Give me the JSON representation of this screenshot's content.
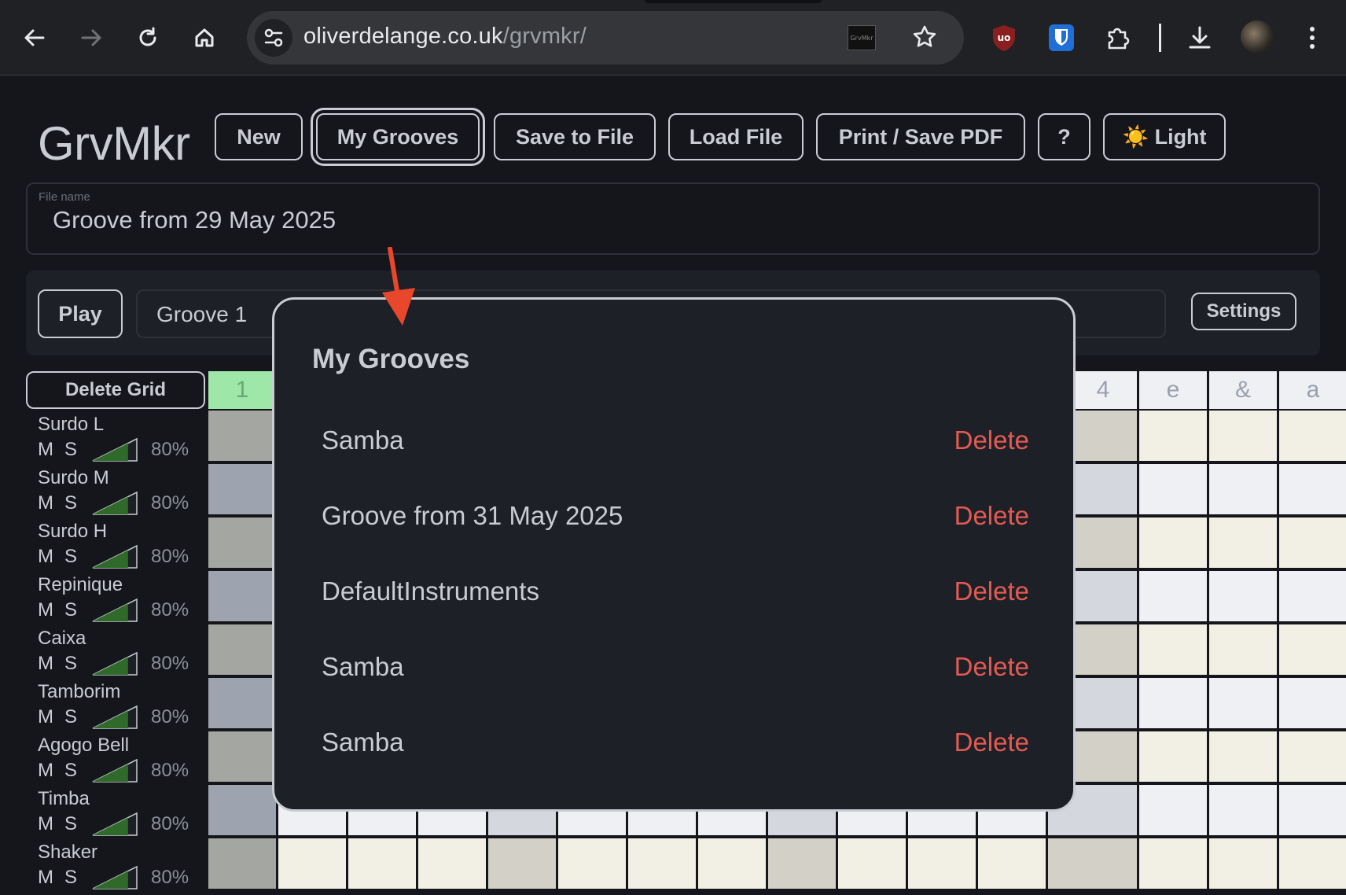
{
  "browser": {
    "url_domain": "oliverdelange.co.uk",
    "url_path": "/grvmkr/",
    "extension_thumb_label": "GrvMkr"
  },
  "app": {
    "logo": "GrvMkr",
    "toolbar": {
      "new_label": "New",
      "my_grooves_label": "My Grooves",
      "save_label": "Save to File",
      "load_label": "Load File",
      "print_label": "Print / Save PDF",
      "help_label": "?",
      "theme_label": "☀️ Light"
    },
    "file_name_label": "File name",
    "file_name_value": "Groove from 29 May 2025",
    "play_label": "Play",
    "groove_name": "Groove 1",
    "settings_label": "Settings",
    "delete_grid_label": "Delete Grid",
    "beat_headers": [
      "1",
      "4",
      "e",
      "&",
      "a"
    ],
    "instruments": [
      {
        "name": "Surdo L",
        "mute": "M",
        "solo": "S",
        "volume": "80%",
        "volume_level": 0.8
      },
      {
        "name": "Surdo M",
        "mute": "M",
        "solo": "S",
        "volume": "80%",
        "volume_level": 0.8
      },
      {
        "name": "Surdo H",
        "mute": "M",
        "solo": "S",
        "volume": "80%",
        "volume_level": 0.8
      },
      {
        "name": "Repinique",
        "mute": "M",
        "solo": "S",
        "volume": "80%",
        "volume_level": 0.8
      },
      {
        "name": "Caixa",
        "mute": "M",
        "solo": "S",
        "volume": "80%",
        "volume_level": 0.8
      },
      {
        "name": "Tamborim",
        "mute": "M",
        "solo": "S",
        "volume": "80%",
        "volume_level": 0.8
      },
      {
        "name": "Agogo Bell",
        "mute": "M",
        "solo": "S",
        "volume": "80%",
        "volume_level": 0.8
      },
      {
        "name": "Timba",
        "mute": "M",
        "solo": "S",
        "volume": "80%",
        "volume_level": 0.8
      },
      {
        "name": "Shaker",
        "mute": "M",
        "solo": "S",
        "volume": "80%",
        "volume_level": 0.8
      }
    ]
  },
  "modal": {
    "title": "My Grooves",
    "items": [
      {
        "name": "Samba",
        "delete_label": "Delete"
      },
      {
        "name": "Groove from 31 May 2025",
        "delete_label": "Delete"
      },
      {
        "name": "DefaultInstruments",
        "delete_label": "Delete"
      },
      {
        "name": "Samba",
        "delete_label": "Delete"
      },
      {
        "name": "Samba",
        "delete_label": "Delete"
      }
    ]
  },
  "colors": {
    "accent_delete": "#e35a52",
    "annotation_arrow": "#e8472b",
    "beat_highlight": "#9fe6a9"
  }
}
